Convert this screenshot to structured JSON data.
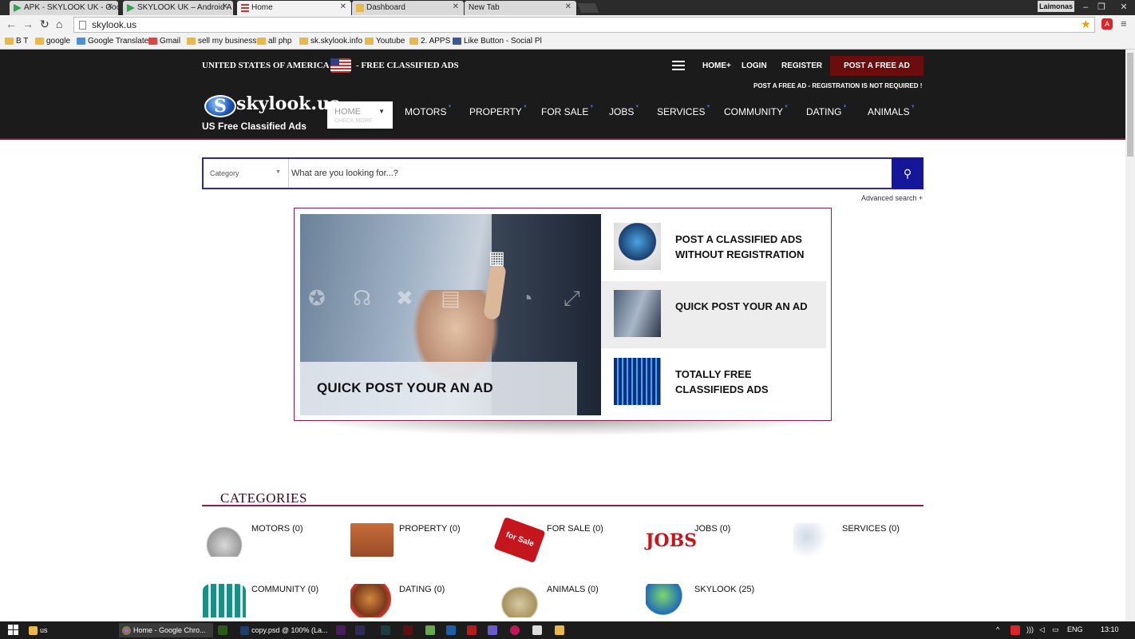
{
  "browser": {
    "tabs": [
      {
        "title": "APK - SKYLOOK UK - Goo"
      },
      {
        "title": "SKYLOOK UK – Android A"
      },
      {
        "title": "Home"
      },
      {
        "title": "Dashboard"
      },
      {
        "title": "New Tab"
      }
    ],
    "profile": "Laimonas",
    "url": "skylook.us",
    "bookmarks": [
      "B T",
      "google",
      "Google Translate",
      "Gmail",
      "sell my business",
      "all php",
      "sk.skylook.info",
      "Youtube",
      "2. APPS",
      "Like Button - Social Pl"
    ]
  },
  "header": {
    "country": "UNITED STATES OF AMERICA",
    "country_suffix": "- FREE CLASSIFIED ADS",
    "links": {
      "home": "HOME+",
      "login": "LOGIN",
      "register": "REGISTER"
    },
    "post_ad": "POST A FREE AD",
    "post_note": "POST A FREE AD - REGISTRATION IS NOT REQUIRED !",
    "logo_letter": "S",
    "logo_text": "skylook.us",
    "tagline": "US Free Classified Ads",
    "home_box": {
      "label": "HOME",
      "sub": "CHECK MORE"
    },
    "nav": [
      "MOTORS",
      "PROPERTY",
      "FOR SALE",
      "JOBS",
      "SERVICES",
      "COMMUNITY",
      "DATING",
      "ANIMALS"
    ]
  },
  "search": {
    "category_label": "Category",
    "placeholder": "What are you looking for...?",
    "advanced": "Advanced search +"
  },
  "slider": {
    "caption": "QUICK POST YOUR AN AD",
    "items": [
      {
        "text": "POST A CLASSIFIED ADS WITHOUT REGISTRATION"
      },
      {
        "text": "QUICK POST YOUR AN AD"
      },
      {
        "text": "TOTALLY FREE CLASSIFIEDS ADS"
      }
    ],
    "active_index": 1
  },
  "categories": {
    "heading": "CATEGORIES",
    "items": [
      {
        "label": "MOTORS (0)"
      },
      {
        "label": "PROPERTY (0)"
      },
      {
        "label": "FOR SALE (0)",
        "pic_text": "for Sale"
      },
      {
        "label": "JOBS (0)",
        "pic_text": "JOBS"
      },
      {
        "label": "SERVICES (0)"
      },
      {
        "label": "COMMUNITY (0)"
      },
      {
        "label": "DATING (0)"
      },
      {
        "label": "ANIMALS (0)"
      },
      {
        "label": "SKYLOOK (25)"
      }
    ]
  },
  "taskbar": {
    "items": [
      "us",
      "Home - Google Chro...",
      "copy.psd @ 100% (La..."
    ],
    "lang": "ENG",
    "time": "13:10"
  },
  "colors": {
    "header_bg": "#1b1b1b",
    "accent": "#8b1e4c",
    "post_btn": "#6b0d0d",
    "search_btn": "#16169a"
  }
}
